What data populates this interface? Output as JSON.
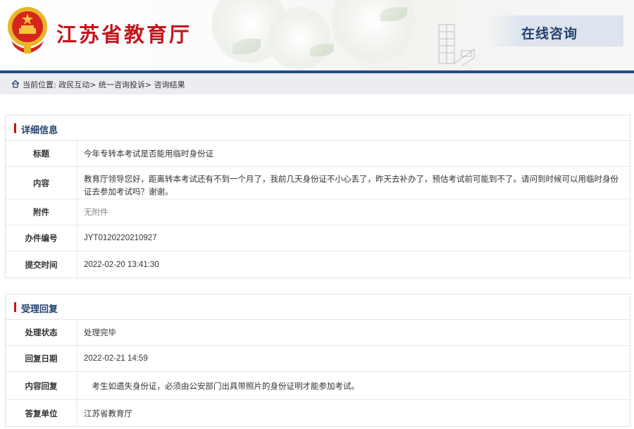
{
  "header": {
    "site_title": "江苏省教育厅",
    "banner_label": "在线咨询",
    "colors": {
      "title_red": "#c4161c",
      "nav_blue": "#1f4e8c",
      "heading_blue": "#23426e"
    }
  },
  "breadcrumb": {
    "icon": "home-icon",
    "text": "当前位置: 政民互动> 统一咨询投诉> 咨询结果"
  },
  "detail": {
    "title": "详细信息",
    "rows": [
      {
        "label": "标题",
        "value": "今年专转本考试是否能用临时身份证"
      },
      {
        "label": "内容",
        "value": "教育厅领导您好，距离转本考试还有不到一个月了，我前几天身份证不小心丢了，昨天去补办了，预估考试前可能到不了。请问到时候可以用临时身份证去参加考试吗？谢谢。"
      },
      {
        "label": "附件",
        "value": "无附件"
      },
      {
        "label": "办件编号",
        "value": "JYT0120220210927"
      },
      {
        "label": "提交时间",
        "value": "2022-02-20 13:41:30"
      }
    ]
  },
  "reply": {
    "title": "受理回复",
    "rows": [
      {
        "label": "处理状态",
        "value": "处理完毕"
      },
      {
        "label": "回复日期",
        "value": "2022-02-21 14:59"
      },
      {
        "label": "内容回复",
        "value": "　考生如遗失身份证，必须由公安部门出具带照片的身份证明才能参加考试。"
      },
      {
        "label": "答复单位",
        "value": "江苏省教育厅"
      }
    ]
  }
}
